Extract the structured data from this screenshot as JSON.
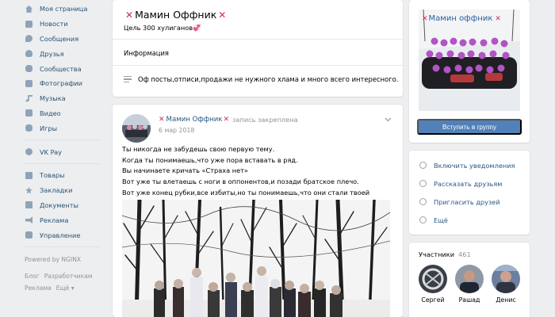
{
  "sidebar": {
    "items": [
      {
        "label": "Моя страница",
        "icon": "home-icon"
      },
      {
        "label": "Новости",
        "icon": "news-icon"
      },
      {
        "label": "Сообщения",
        "icon": "messages-icon"
      },
      {
        "label": "Друзья",
        "icon": "friends-icon"
      },
      {
        "label": "Сообщества",
        "icon": "communities-icon"
      },
      {
        "label": "Фотографии",
        "icon": "photos-icon"
      },
      {
        "label": "Музыка",
        "icon": "music-icon"
      },
      {
        "label": "Видео",
        "icon": "video-icon"
      },
      {
        "label": "Игры",
        "icon": "games-icon"
      },
      {
        "label": "VK Pay",
        "icon": "vkpay-icon"
      },
      {
        "label": "Товары",
        "icon": "goods-icon"
      },
      {
        "label": "Закладки",
        "icon": "bookmarks-icon"
      },
      {
        "label": "Документы",
        "icon": "documents-icon"
      },
      {
        "label": "Реклама",
        "icon": "ads-icon"
      },
      {
        "label": "Управление",
        "icon": "manage-icon"
      }
    ],
    "footer": {
      "powered": "Powered by NGINX",
      "links": [
        "Блог",
        "Разработчикам",
        "Реклама",
        "Ещё ▾"
      ]
    }
  },
  "group": {
    "name": "Мамин Оффник",
    "status": "Цель 300 хулиганов💞",
    "info_title": "Информация",
    "description": "Оф посты,отписи,продажи не нужного хлама и много всего интересного."
  },
  "post": {
    "author": "Мамин Оффник",
    "pinned_label": "запись закреплена",
    "date": "6 мар 2018",
    "lines": [
      "Ты никогда не забудешь свою первую тему.",
      "Когда ты понимаешь,что уже пора вставать в ряд.",
      "Вы начинаете кричать «Страха нет»",
      "Вот уже ты влетаешь с ноги в оппонентов,и позади братское плечо.",
      "Вот уже конец рубки,все избиты,но ты понимаешь,что они стали твоей семьей."
    ]
  },
  "cover": {
    "caption": "Мамин  оффник",
    "join_label": "Вступить в группу"
  },
  "actions": [
    {
      "label": "Включить уведомления",
      "icon": "bell-icon"
    },
    {
      "label": "Рассказать друзьям",
      "icon": "share-icon"
    },
    {
      "label": "Пригласить друзей",
      "icon": "invite-icon"
    },
    {
      "label": "Ещё",
      "icon": "more-icon"
    }
  ],
  "members": {
    "title": "Участники",
    "count": "461",
    "people": [
      {
        "name": "Сергей"
      },
      {
        "name": "Рашад"
      },
      {
        "name": "Денис"
      }
    ]
  },
  "colors": {
    "accent": "#5181b8",
    "link": "#2a5885",
    "mark": "#e0245e"
  }
}
